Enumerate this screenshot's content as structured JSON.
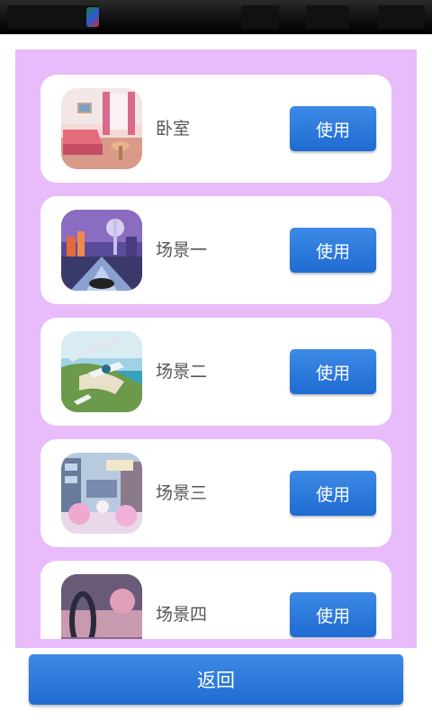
{
  "scenes": [
    {
      "label": "卧室",
      "button": "使用",
      "thumbnail": "bedroom-thumbnail"
    },
    {
      "label": "场景一",
      "button": "使用",
      "thumbnail": "city-scene-thumbnail"
    },
    {
      "label": "场景二",
      "button": "使用",
      "thumbnail": "coast-scene-thumbnail"
    },
    {
      "label": "场景三",
      "button": "使用",
      "thumbnail": "street-scene-thumbnail"
    },
    {
      "label": "场景四",
      "button": "使用",
      "thumbnail": "portal-scene-thumbnail"
    }
  ],
  "footer": {
    "back_label": "返回"
  },
  "colors": {
    "panel_background": "#e8bbfa",
    "button_blue": "#2a7ad9",
    "card_background": "#ffffff",
    "label_text": "#555555"
  }
}
